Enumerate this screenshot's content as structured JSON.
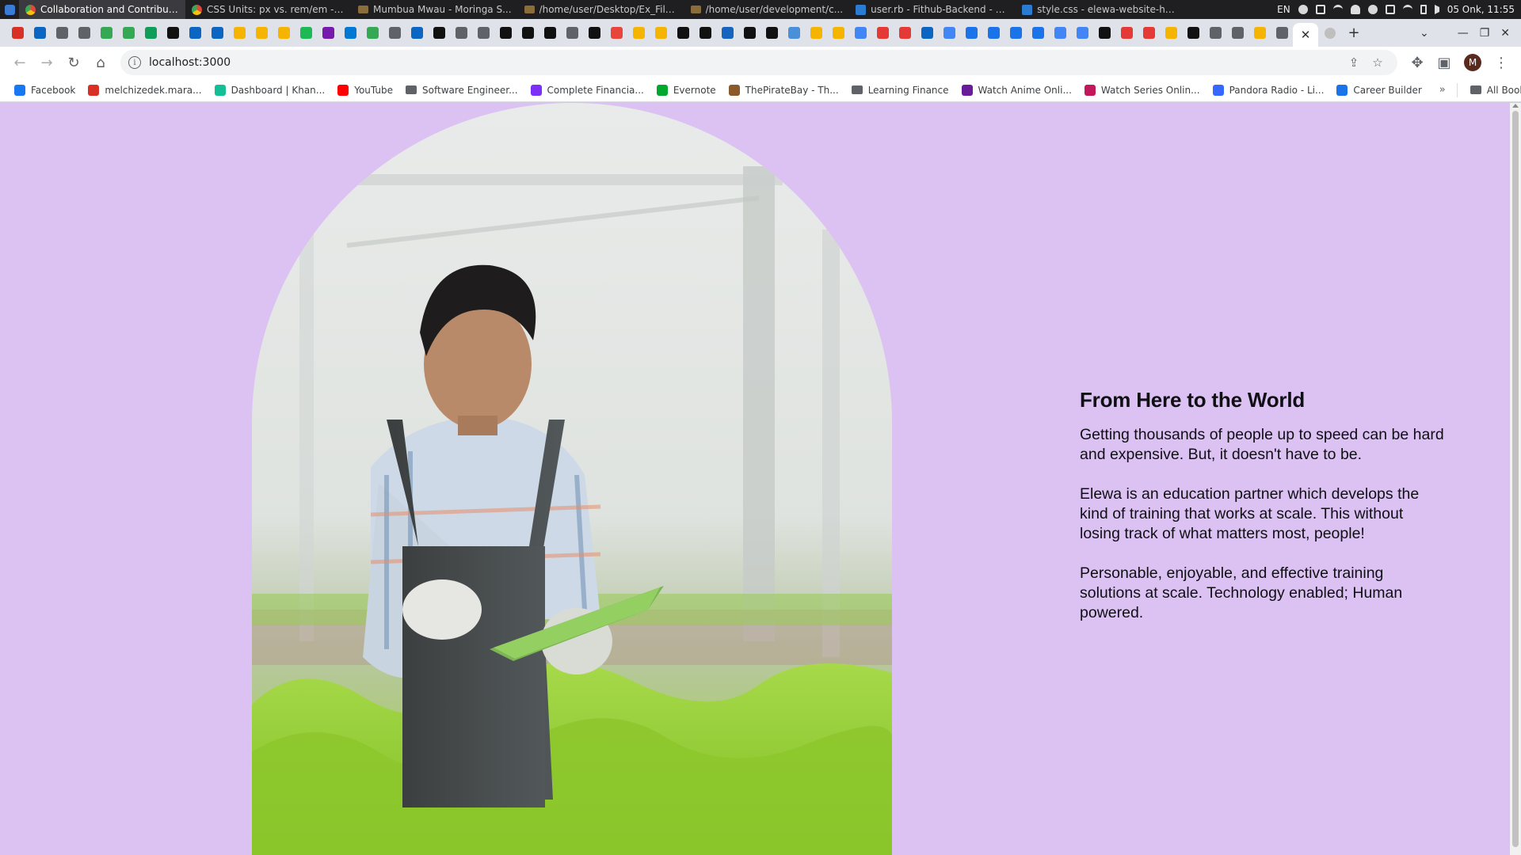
{
  "os_bar": {
    "windows": [
      {
        "title": "Collaboration and Contributi...",
        "icon": "chrome-icon",
        "active": true
      },
      {
        "title": "CSS Units: px vs. rem/em - G...",
        "icon": "chrome-icon"
      },
      {
        "title": "Mumbua Mwau - Moringa S...",
        "icon": "folder-icon"
      },
      {
        "title": "/home/user/Desktop/Ex_File...",
        "icon": "folder-icon"
      },
      {
        "title": "/home/user/development/c...",
        "icon": "folder-icon"
      },
      {
        "title": "user.rb - Fithub-Backend - Vi...",
        "icon": "vscode-icon"
      },
      {
        "title": "style.css - elewa-website-ht...",
        "icon": "vscode-icon"
      }
    ],
    "language": "EN",
    "clock": "05 Onk, 11:55"
  },
  "tabstrip": {
    "pinned_colors": [
      "#d93025",
      "#0a66c2",
      "#5f6368",
      "#5f6368",
      "#34a853",
      "#34a853",
      "#0f9d58",
      "#111111",
      "#0a66c2",
      "#0a66c2",
      "#f4b400",
      "#f4b400",
      "#f4b400",
      "#1db954",
      "#7719aa",
      "#0078d4",
      "#34a853",
      "#5f6368",
      "#0a66c2",
      "#111111",
      "#5f6368",
      "#5f6368",
      "#111111",
      "#111111",
      "#111111",
      "#5f6368",
      "#111111",
      "#e8453c",
      "#f4b400",
      "#f4b400",
      "#111111",
      "#111111",
      "#1565c0",
      "#111111",
      "#111111",
      "#4a90d9",
      "#f4b400",
      "#f4b400",
      "#4285f4",
      "#e53935",
      "#e53935",
      "#0a66c2",
      "#4285f4",
      "#1a73e8",
      "#1a73e8",
      "#1a73e8",
      "#1a73e8",
      "#4285f4",
      "#4285f4",
      "#111111",
      "#e53935",
      "#e53935",
      "#f4b400",
      "#111111",
      "#5f6368",
      "#5f6368",
      "#f4b400",
      "#5f6368"
    ],
    "current_tab_icon": "close-icon"
  },
  "toolbar": {
    "url": "localhost:3000",
    "profile_initial": "M"
  },
  "bookmarks": {
    "items": [
      {
        "label": "Facebook",
        "color": "#1877f2"
      },
      {
        "label": "melchizedek.mara...",
        "color": "#d93025"
      },
      {
        "label": "Dashboard | Khan...",
        "color": "#14bf96"
      },
      {
        "label": "YouTube",
        "color": "#ff0000"
      },
      {
        "label": "Software Engineer...",
        "color": "#5f6368",
        "folder": true
      },
      {
        "label": "Complete Financia...",
        "color": "#7b2ff7"
      },
      {
        "label": "Evernote",
        "color": "#00a82d"
      },
      {
        "label": "ThePirateBay - Th...",
        "color": "#8b5a2b"
      },
      {
        "label": "Learning Finance",
        "color": "#5f6368",
        "folder": true
      },
      {
        "label": "Watch Anime Onli...",
        "color": "#6a1b9a"
      },
      {
        "label": "Watch Series Onlin...",
        "color": "#c2185b"
      },
      {
        "label": "Pandora Radio - Li...",
        "color": "#3668ff"
      },
      {
        "label": "Career Builder",
        "color": "#1a73e8"
      }
    ],
    "more": "»",
    "all_bookmarks": "All Bookmarks"
  },
  "page": {
    "heading": "From Here to the World",
    "paragraphs": [
      "Getting thousands of people up to speed can be hard and expensive. But, it doesn't have to be.",
      "Elewa is an education partner which develops the kind of training that works at scale. This without losing track of what matters most, people!",
      "Personable, enjoyable, and effective training solutions at scale. Technology enabled; Human powered."
    ],
    "background_color": "#dcc2f2"
  }
}
